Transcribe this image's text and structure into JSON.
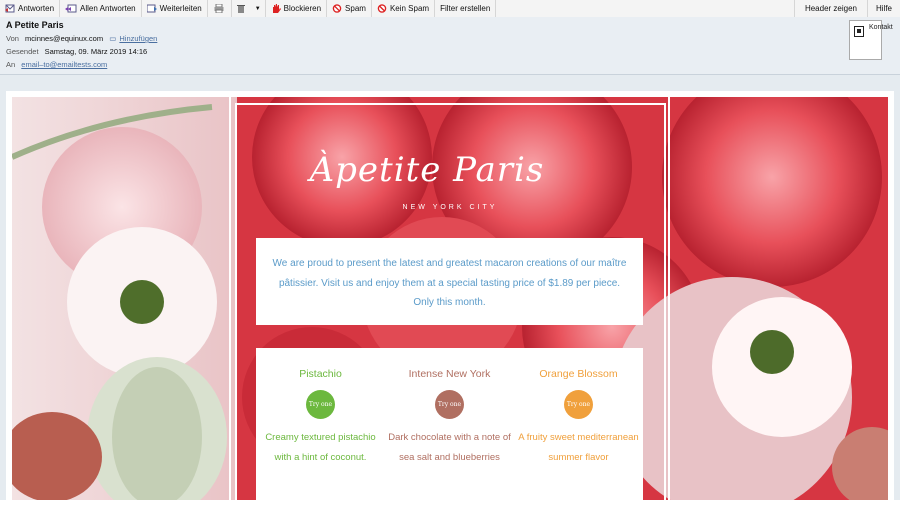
{
  "toolbar": {
    "reply": "Antworten",
    "reply_all": "Allen Antworten",
    "forward": "Weiterleiten",
    "block": "Blockieren",
    "spam": "Spam",
    "not_spam": "Kein Spam",
    "create_filter": "Filter erstellen",
    "show_headers": "Header zeigen",
    "help": "Hilfe"
  },
  "header": {
    "subject": "A Petite Paris",
    "from_label": "Von",
    "from_value": "mcinnes@equinux.com",
    "add_link": "Hinzufügen",
    "sent_label": "Gesendet",
    "sent_value": "Samstag, 09. März 2019 14:16",
    "to_label": "An",
    "to_value": "email–to@emailtests.com",
    "contact_button": "Kontakt"
  },
  "email": {
    "logo": "Àpetite Paris",
    "city": "NEW YORK CITY",
    "intro": "We are proud to present the latest and greatest macaron creations of our maître pâtissier. Visit us and enjoy them at a special tasting price of $1.89 per piece. Only this month.",
    "flavors": [
      {
        "name": "Pistachio",
        "button": "Try one",
        "color": "#6cb83e",
        "desc": "Creamy textured pistachio with a hint of coconut."
      },
      {
        "name": "Intense New York",
        "button": "Try one",
        "color": "#b06f61",
        "desc": "Dark chocolate with a note of sea salt and blueberries"
      },
      {
        "name": "Orange Blossom",
        "button": "Try one",
        "color": "#f0a03c",
        "desc": "A fruity sweet mediterranean summer flavor"
      }
    ]
  }
}
